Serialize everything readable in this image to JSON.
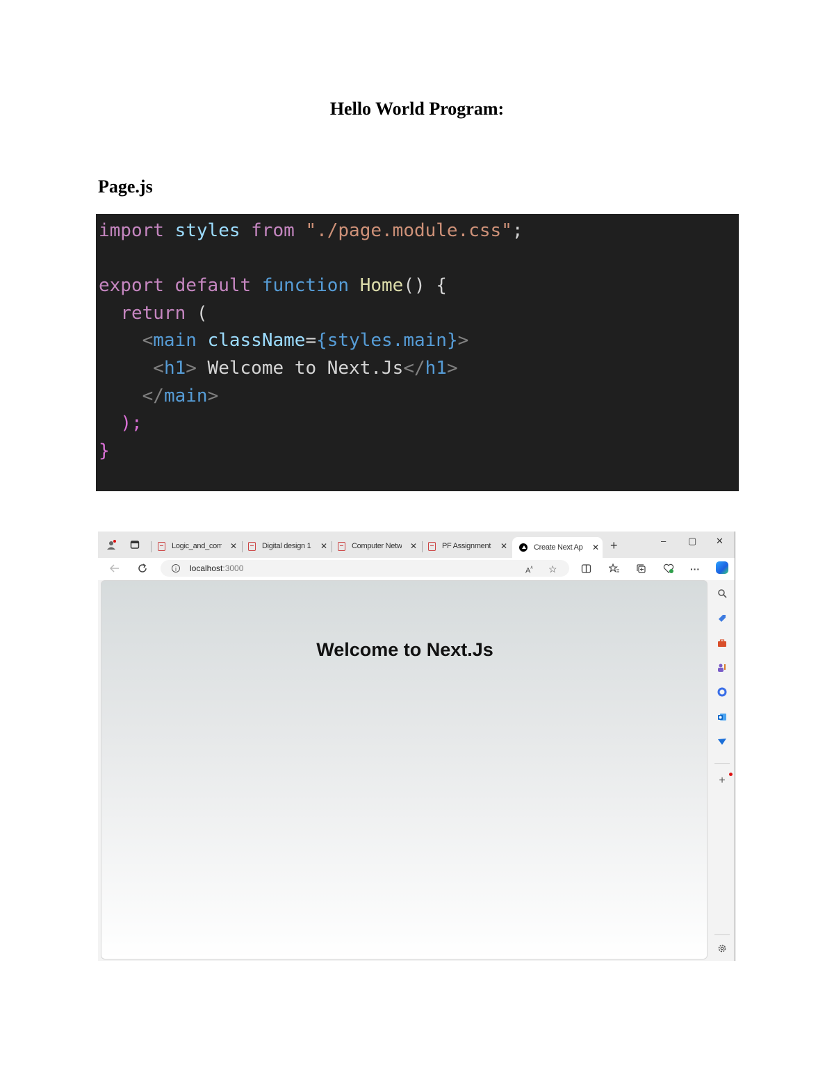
{
  "doc": {
    "title": "Hello World Program:",
    "file_label": "Page.js"
  },
  "code": {
    "l1_import": "import",
    "l1_styles": "styles",
    "l1_from": "from",
    "l1_path": "\"./page.module.css\"",
    "l1_semi": ";",
    "l3_export": "export",
    "l3_default": "default",
    "l3_function": "function",
    "l3_name": "Home",
    "l3_rest": "() {",
    "l4_return": "return",
    "l4_paren": " (",
    "l5_open": "<",
    "l5_tag": "main",
    "l5_attr": "className",
    "l5_eq": "=",
    "l5_expr": "{styles.main}",
    "l5_close": ">",
    "l6_open": "<",
    "l6_tag": "h1",
    "l6_close": ">",
    "l6_text": " Welcome to Next.Js",
    "l6_endopen": "</",
    "l6_endtag": "h1",
    "l6_endclose": ">",
    "l7_open": "</",
    "l7_tag": "main",
    "l7_close": ">",
    "l8": ");",
    "l9": "}"
  },
  "browser": {
    "tabs": [
      {
        "label": "Logic_and_com",
        "close": "✕"
      },
      {
        "label": "Digital design 1",
        "close": "✕"
      },
      {
        "label": "Computer Netw",
        "close": "✕"
      },
      {
        "label": "PF Assignment",
        "close": "✕"
      },
      {
        "label": "Create Next Ap",
        "close": "✕"
      }
    ],
    "new_tab": "+",
    "minimize": "–",
    "maximize": "▢",
    "close_window": "✕",
    "url_host": "localhost",
    "url_port": ":3000",
    "page_heading": "Welcome to Next.Js"
  },
  "icons": {
    "profile": "profile-icon",
    "workspaces": "tab-actions-icon",
    "back": "back-arrow-icon",
    "refresh": "refresh-icon",
    "info": "info-icon",
    "read_aloud": "read-aloud-icon",
    "favorite": "star-icon",
    "split": "split-screen-icon",
    "favorites": "favorites-icon",
    "collections": "collections-icon",
    "health": "browser-essentials-icon",
    "more": "more-icon",
    "settings": "gear-icon"
  }
}
